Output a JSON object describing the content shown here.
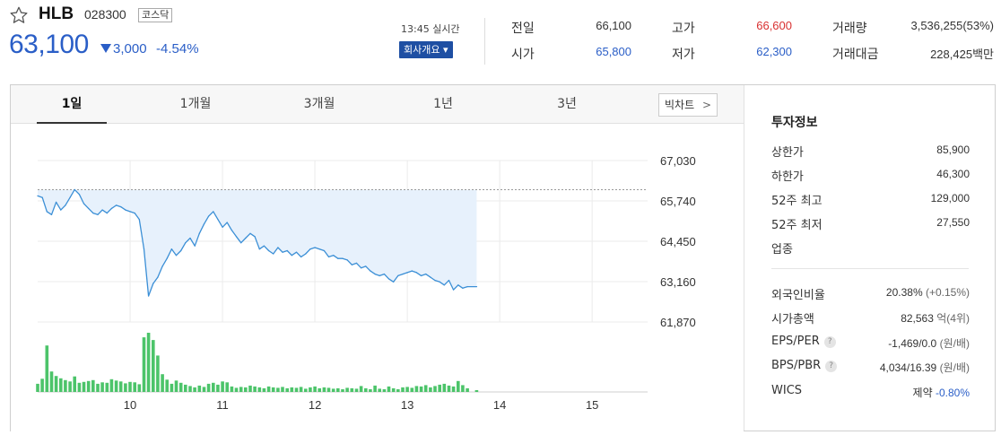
{
  "stock": {
    "name": "HLB",
    "code": "028300",
    "market": "코스닥",
    "price": "63,100",
    "change": "3,000",
    "change_pct": "-4.54%",
    "time": "13:45 실시간",
    "company_btn": "회사개요 ▾"
  },
  "quote": {
    "prev_close_label": "전일",
    "prev_close": "66,100",
    "open_label": "시가",
    "open": "65,800",
    "high_label": "고가",
    "high": "66,600",
    "low_label": "저가",
    "low": "62,300",
    "volume_label": "거래량",
    "volume": "3,536,255(53%)",
    "amount_label": "거래대금",
    "amount": "228,425백만"
  },
  "colors": {
    "up": "#d83131",
    "down": "#2a5ec7",
    "volume": "#4cc46a",
    "line": "#3b8fd6",
    "fill": "#e7f1fc"
  },
  "tabs": [
    {
      "label": "1일",
      "active": true
    },
    {
      "label": "1개월",
      "active": false
    },
    {
      "label": "3개월",
      "active": false
    },
    {
      "label": "1년",
      "active": false
    },
    {
      "label": "3년",
      "active": false
    }
  ],
  "bigchart_label": "빅차트",
  "investment": {
    "title": "투자정보",
    "upper_limit_label": "상한가",
    "upper_limit": "85,900",
    "lower_limit_label": "하한가",
    "lower_limit": "46,300",
    "high52_label": "52주 최고",
    "high52": "129,000",
    "low52_label": "52주 최저",
    "low52": "27,550",
    "sector_label": "업종",
    "foreign_label": "외국인비율",
    "foreign": "20.38%",
    "foreign_sub": "(+0.15%)",
    "mktcap_label": "시가총액",
    "mktcap": "82,563",
    "mktcap_sub": "억(4위)",
    "eps_label": "EPS/PER",
    "eps": "-1,469/0.0",
    "eps_sub": "(원/배)",
    "bps_label": "BPS/PBR",
    "bps": "4,034/16.39",
    "bps_sub": "(원/배)",
    "wics_label": "WICS",
    "wics": "제약",
    "wics_sub": "-0.80%",
    "help_glyph": "?"
  },
  "chart_data": {
    "type": "line",
    "x_tick_labels": [
      "10",
      "11",
      "12",
      "13",
      "14",
      "15"
    ],
    "y_tick_labels": [
      "67,030",
      "65,740",
      "64,450",
      "63,160",
      "61,870"
    ],
    "ylim": [
      61870,
      67030
    ],
    "prev_close": 66100,
    "x": [
      9.0,
      9.05,
      9.1,
      9.15,
      9.2,
      9.25,
      9.3,
      9.35,
      9.4,
      9.45,
      9.5,
      9.55,
      9.6,
      9.65,
      9.7,
      9.75,
      9.8,
      9.85,
      9.9,
      9.95,
      10.0,
      10.05,
      10.1,
      10.15,
      10.2,
      10.25,
      10.3,
      10.35,
      10.4,
      10.45,
      10.5,
      10.55,
      10.6,
      10.65,
      10.7,
      10.75,
      10.8,
      10.85,
      10.9,
      10.95,
      11.0,
      11.05,
      11.1,
      11.15,
      11.2,
      11.25,
      11.3,
      11.35,
      11.4,
      11.45,
      11.5,
      11.55,
      11.6,
      11.65,
      11.7,
      11.75,
      11.8,
      11.85,
      11.9,
      11.95,
      12.0,
      12.05,
      12.1,
      12.15,
      12.2,
      12.25,
      12.3,
      12.35,
      12.4,
      12.45,
      12.5,
      12.55,
      12.6,
      12.65,
      12.7,
      12.75,
      12.8,
      12.85,
      12.9,
      12.95,
      13.0,
      13.05,
      13.1,
      13.15,
      13.2,
      13.25,
      13.3,
      13.35,
      13.4,
      13.45,
      13.5,
      13.55,
      13.6,
      13.65,
      13.75
    ],
    "values": [
      65900,
      65850,
      65400,
      65300,
      65700,
      65450,
      65600,
      65850,
      66100,
      65950,
      65650,
      65500,
      65350,
      65300,
      65450,
      65350,
      65500,
      65600,
      65550,
      65450,
      65400,
      65350,
      65150,
      64200,
      62700,
      63100,
      63300,
      63650,
      63900,
      64200,
      64000,
      64150,
      64400,
      64550,
      64300,
      64700,
      65000,
      65250,
      65400,
      65150,
      64900,
      65050,
      64800,
      64600,
      64400,
      64550,
      64700,
      64600,
      64200,
      64300,
      64150,
      64050,
      64250,
      64100,
      64150,
      64000,
      64100,
      63950,
      64050,
      64200,
      64250,
      64200,
      64150,
      63950,
      64000,
      63900,
      63900,
      63850,
      63700,
      63750,
      63600,
      63650,
      63500,
      63400,
      63350,
      63400,
      63250,
      63150,
      63350,
      63400,
      63450,
      63500,
      63450,
      63350,
      63400,
      63300,
      63200,
      63150,
      63050,
      63200,
      62900,
      63050,
      62950,
      63000,
      63000
    ],
    "volume_values": [
      1.8,
      2.9,
      10.2,
      4.5,
      3.5,
      3.0,
      2.6,
      2.3,
      3.4,
      2.0,
      2.2,
      2.4,
      2.6,
      1.8,
      2.1,
      2.0,
      2.8,
      2.5,
      2.3,
      1.9,
      2.2,
      2.1,
      1.7,
      12.0,
      13.0,
      11.4,
      8.0,
      3.9,
      2.7,
      1.8,
      2.5,
      2.0,
      1.6,
      1.3,
      1.0,
      1.4,
      1.1,
      1.8,
      2.0,
      1.6,
      2.3,
      2.1,
      1.2,
      0.9,
      1.1,
      1.0,
      1.4,
      1.2,
      1.0,
      0.8,
      1.2,
      1.0,
      0.9,
      1.1,
      0.8,
      1.0,
      0.9,
      1.1,
      0.7,
      1.0,
      1.2,
      0.8,
      1.0,
      0.9,
      0.7,
      0.8,
      0.6,
      0.9,
      0.8,
      0.7,
      1.3,
      0.8,
      0.6,
      1.4,
      0.7,
      0.6,
      1.2,
      0.8,
      0.6,
      1.0,
      1.1,
      0.9,
      1.3,
      1.2,
      1.5,
      1.0,
      1.3,
      1.6,
      1.8,
      1.4,
      1.2,
      2.4,
      1.5,
      0.8,
      0.4
    ],
    "grid": true
  }
}
